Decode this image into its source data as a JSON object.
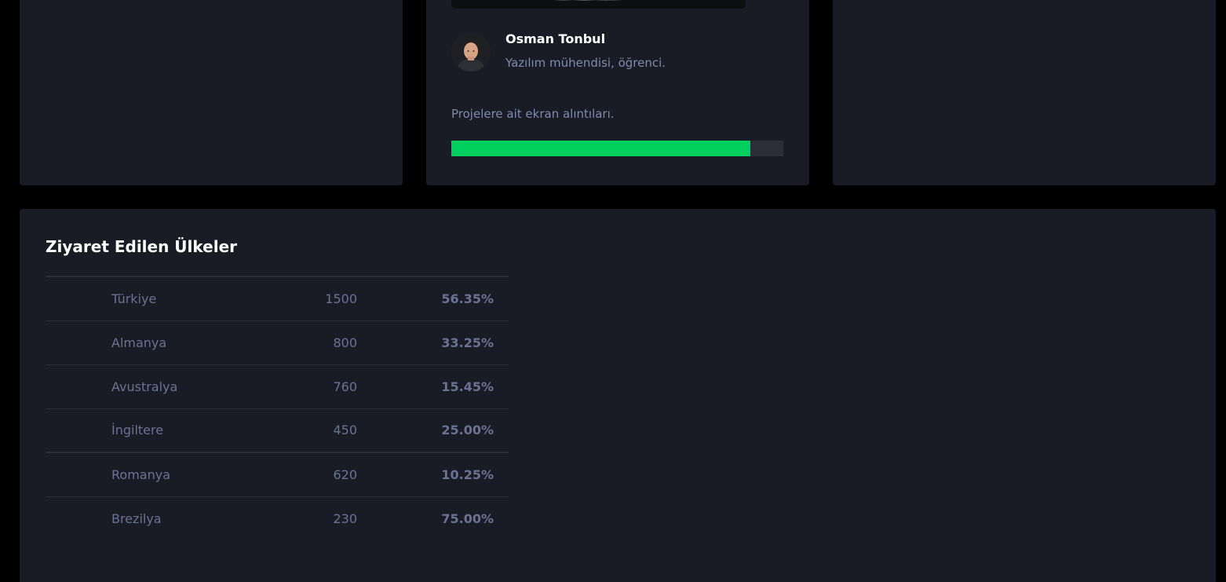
{
  "profile_card": {
    "author_name": "Osman Tonbul",
    "author_role": "Yazılım mühendisi, öğrenci.",
    "caption": "Projelere ait ekran alıntıları.",
    "progress_percent": 90,
    "progress_color": "#00d15e"
  },
  "countries": {
    "title": "Ziyaret Edilen Ülkeler",
    "rows": [
      {
        "name": "Türkiye",
        "visits": "1500",
        "percent": "56.35%"
      },
      {
        "name": "Almanya",
        "visits": "800",
        "percent": "33.25%"
      },
      {
        "name": "Avustralya",
        "visits": "760",
        "percent": "15.45%"
      },
      {
        "name": "İngiltere",
        "visits": "450",
        "percent": "25.00%"
      },
      {
        "name": "Romanya",
        "visits": "620",
        "percent": "10.25%"
      },
      {
        "name": "Brezilya",
        "visits": "230",
        "percent": "75.00%"
      }
    ]
  },
  "colors": {
    "page_background": "#000000",
    "card_background": "#1a1c25",
    "muted_text": "#8388ad",
    "table_text": "#6d7194",
    "accent_green": "#00d15e"
  }
}
